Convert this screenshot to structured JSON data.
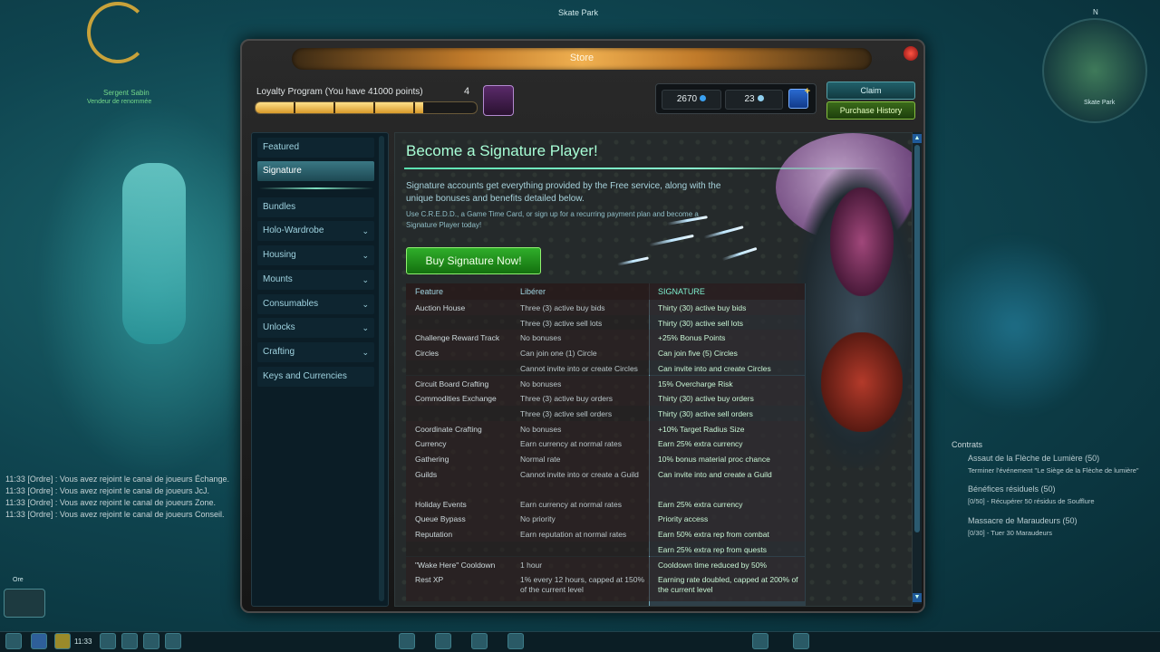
{
  "scene": {
    "location": "Skate Park",
    "npc_name": "Sergent Sabin",
    "npc_role": "Vendeur de renommée",
    "compass_n": "N",
    "minimap_label": "Skate Park",
    "party_label": "Ore"
  },
  "chat": [
    {
      "time": "11:33",
      "text": "[Ordre] : Vous avez rejoint le canal de joueurs Échange."
    },
    {
      "time": "11:33",
      "text": "[Ordre] : Vous avez rejoint le canal de joueurs JcJ."
    },
    {
      "time": "11:33",
      "text": "[Ordre] : Vous avez rejoint le canal de joueurs Zone."
    },
    {
      "time": "11:33",
      "text": "[Ordre] : Vous avez rejoint le canal de joueurs Conseil."
    }
  ],
  "contracts": {
    "title": "Contrats",
    "items": [
      {
        "name": "Assaut de la Flèche de Lumière (50)",
        "detail": "Terminer l'événement \"Le Siège de la Flèche de lumière\""
      },
      {
        "name": "Bénéfices résiduels (50)",
        "detail": "[0/50] - Récupérer 50 résidus de Soufflure"
      },
      {
        "name": "Massacre de Maraudeurs (50)",
        "detail": "[0/30] - Tuer 30 Maraudeurs"
      }
    ]
  },
  "hotbar": {
    "clock": "11:33"
  },
  "store": {
    "title": "Store",
    "loyalty": {
      "label": "Loyalty Program (You have 41000 points)",
      "level": "4",
      "progress": 0.76
    },
    "currencies": [
      {
        "value": "2670",
        "icon": "omnibit-icon"
      },
      {
        "value": "23",
        "icon": "ncoin-icon"
      }
    ],
    "buttons": {
      "claim": "Claim",
      "history": "Purchase History"
    },
    "sidebar": [
      {
        "label": "Featured",
        "chevron": false
      },
      {
        "label": "Signature",
        "chevron": false,
        "active": true
      },
      {
        "label": "Bundles",
        "chevron": false
      },
      {
        "label": "Holo-Wardrobe",
        "chevron": true
      },
      {
        "label": "Housing",
        "chevron": true
      },
      {
        "label": "Mounts",
        "chevron": true
      },
      {
        "label": "Consumables",
        "chevron": true
      },
      {
        "label": "Unlocks",
        "chevron": true
      },
      {
        "label": "Crafting",
        "chevron": true
      },
      {
        "label": "Keys and Currencies",
        "chevron": false
      }
    ],
    "chevron_glyph": "⌄",
    "content": {
      "headline": "Become a Signature Player!",
      "intro": "Signature accounts get everything provided by the Free service, along with the unique bonuses and benefits detailed below.",
      "intro_small": "Use C.R.E.D.D., a Game Time Card, or sign up for a recurring payment plan and become a Signature Player today!",
      "buy_button": "Buy Signature Now!",
      "table": {
        "headers": [
          "Feature",
          "Libérer",
          "SIGNATURE"
        ],
        "rows": [
          [
            "Auction House",
            "Three (3) active buy bids",
            "Thirty (30) active buy bids"
          ],
          [
            "",
            "Three (3) active sell lots",
            "Thirty (30) active sell lots"
          ],
          [
            "Challenge Reward Track",
            "No bonuses",
            "+25% Bonus Points"
          ],
          [
            "Circles",
            "Can join one (1) Circle",
            "Can join five (5) Circles"
          ],
          [
            "",
            "Cannot invite into or create Circles",
            "Can invite into and create Circles"
          ],
          [
            "Circuit Board Crafting",
            "No bonuses",
            "15% Overcharge Risk"
          ],
          [
            "Commodities Exchange",
            "Three (3) active buy orders",
            "Thirty (30) active buy orders"
          ],
          [
            "",
            "Three (3) active sell orders",
            "Thirty (30) active sell orders"
          ],
          [
            "Coordinate Crafting",
            "No bonuses",
            "+10% Target Radius Size"
          ],
          [
            "Currency",
            "Earn currency at normal rates",
            "Earn 25% extra currency"
          ],
          [
            "Gathering",
            "Normal rate",
            "10% bonus material proc chance"
          ],
          [
            "Guilds",
            "Cannot invite into or create a Guild",
            "Can invite into and create a Guild"
          ],
          [
            "Holiday Events",
            "Earn currency at normal rates",
            "Earn 25% extra currency"
          ],
          [
            "Queue Bypass",
            "No priority",
            "Priority access"
          ],
          [
            "Reputation",
            "Earn reputation at normal rates",
            "Earn 50% extra rep from combat"
          ],
          [
            "",
            "",
            "Earn 25% extra rep from quests"
          ],
          [
            "\"Wake Here\" Cooldown",
            "1 hour",
            "Cooldown time reduced by 50%"
          ],
          [
            "Rest XP",
            "1% every 12 hours, capped at 150% of the current level",
            "Earning rate doubled, capped at 200% of the current level"
          ]
        ]
      }
    }
  }
}
